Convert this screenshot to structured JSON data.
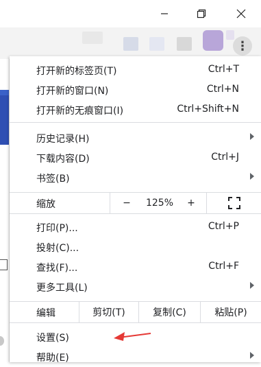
{
  "window": {
    "minimize_icon": "minimize-icon",
    "maximize_icon": "restore-icon",
    "close_icon": "close-icon"
  },
  "toolbar": {
    "menu_icon": "more-vert-icon"
  },
  "menu": {
    "group1": [
      {
        "label": "打开新的标签页(T)",
        "shortcut": "Ctrl+T"
      },
      {
        "label": "打开新的窗口(N)",
        "shortcut": "Ctrl+N"
      },
      {
        "label": "打开新的无痕窗口(I)",
        "shortcut": "Ctrl+Shift+N"
      }
    ],
    "group2": [
      {
        "label": "历史记录(H)",
        "shortcut": ""
      },
      {
        "label": "下载内容(D)",
        "shortcut": "Ctrl+J"
      },
      {
        "label": "书签(B)",
        "shortcut": ""
      }
    ],
    "zoom": {
      "label": "缩放",
      "minus": "−",
      "value": "125%",
      "plus": "+"
    },
    "group3": [
      {
        "label": "打印(P)...",
        "shortcut": "Ctrl+P"
      },
      {
        "label": "投射(C)...",
        "shortcut": ""
      },
      {
        "label": "查找(F)...",
        "shortcut": "Ctrl+F"
      },
      {
        "label": "更多工具(L)",
        "shortcut": ""
      }
    ],
    "edit": {
      "label": "编辑",
      "cut": "剪切(T)",
      "copy": "复制(C)",
      "paste": "粘贴(P)"
    },
    "group4": [
      {
        "label": "设置(S)",
        "shortcut": ""
      },
      {
        "label": "帮助(E)",
        "shortcut": ""
      }
    ]
  },
  "annotation": {
    "arrow_color": "#e53935"
  }
}
